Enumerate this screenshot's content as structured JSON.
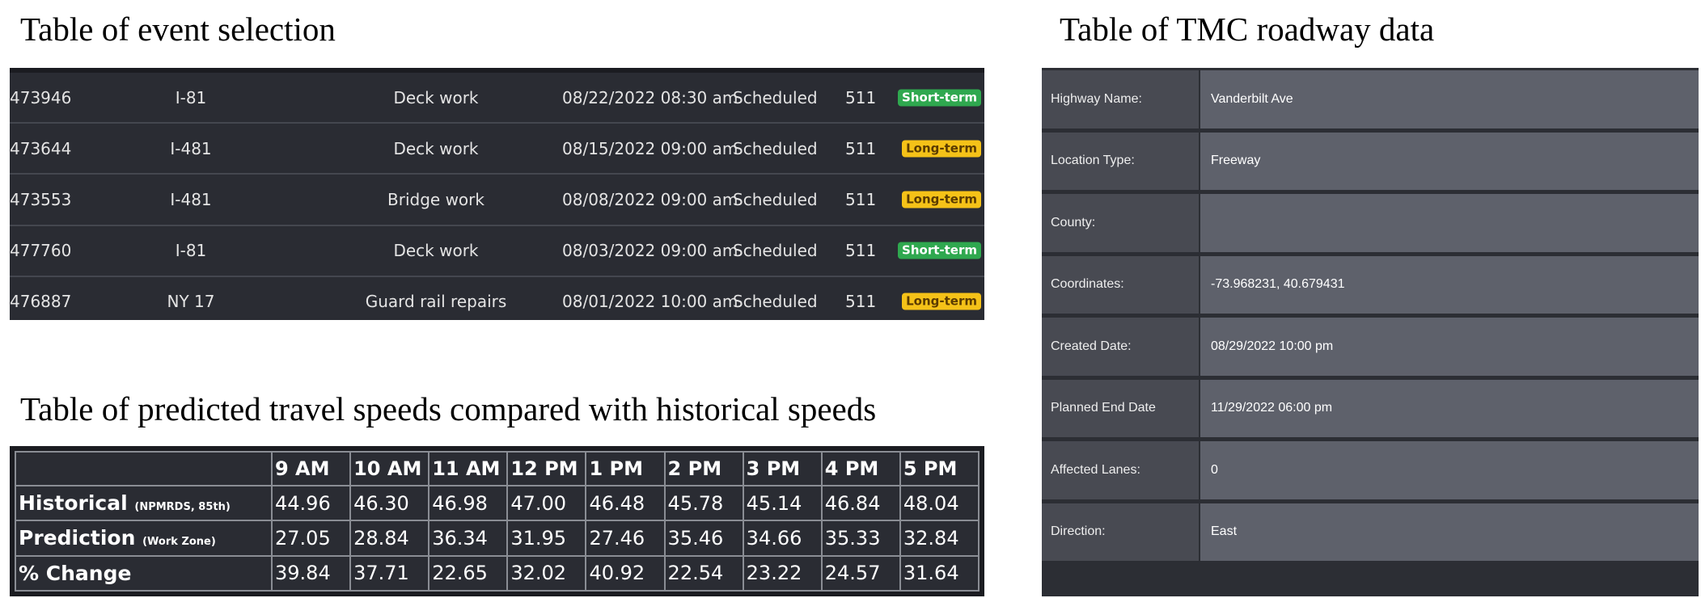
{
  "headings": {
    "events": "Table of event selection",
    "speeds": "Table of predicted travel speeds compared with historical speeds",
    "tmc": "Table of TMC roadway data"
  },
  "events": [
    {
      "id": "473946",
      "road": "I-81",
      "type": "Deck work",
      "date": "08/22/2022 08:30 am",
      "status": "Scheduled",
      "source": "511",
      "duration": "Short-term"
    },
    {
      "id": "473644",
      "road": "I-481",
      "type": "Deck work",
      "date": "08/15/2022 09:00 am",
      "status": "Scheduled",
      "source": "511",
      "duration": "Long-term"
    },
    {
      "id": "473553",
      "road": "I-481",
      "type": "Bridge work",
      "date": "08/08/2022 09:00 am",
      "status": "Scheduled",
      "source": "511",
      "duration": "Long-term"
    },
    {
      "id": "477760",
      "road": "I-81",
      "type": "Deck work",
      "date": "08/03/2022 09:00 am",
      "status": "Scheduled",
      "source": "511",
      "duration": "Short-term"
    },
    {
      "id": "476887",
      "road": "NY 17",
      "type": "Guard rail repairs",
      "date": "08/01/2022 10:00 am",
      "status": "Scheduled",
      "source": "511",
      "duration": "Long-term"
    }
  ],
  "speeds": {
    "hours": [
      "9 AM",
      "10 AM",
      "11 AM",
      "12 PM",
      "1 PM",
      "2 PM",
      "3 PM",
      "4 PM",
      "5 PM"
    ],
    "rows": [
      {
        "label": "Historical",
        "note": "(NPMRDS, 85th)",
        "values": [
          "44.96",
          "46.30",
          "46.98",
          "47.00",
          "46.48",
          "45.78",
          "45.14",
          "46.84",
          "48.04"
        ]
      },
      {
        "label": "Prediction",
        "note": "(Work Zone)",
        "values": [
          "27.05",
          "28.84",
          "36.34",
          "31.95",
          "27.46",
          "35.46",
          "34.66",
          "35.33",
          "32.84"
        ]
      },
      {
        "label": "% Change",
        "note": "",
        "values": [
          "39.84",
          "37.71",
          "22.65",
          "32.02",
          "40.92",
          "22.54",
          "23.22",
          "24.57",
          "31.64"
        ]
      }
    ]
  },
  "tmc": [
    {
      "label": "Highway Name:",
      "value": "Vanderbilt Ave"
    },
    {
      "label": "Location Type:",
      "value": "Freeway"
    },
    {
      "label": "County:",
      "value": ""
    },
    {
      "label": "Coordinates:",
      "value": "-73.968231, 40.679431"
    },
    {
      "label": "Created Date:",
      "value": "08/29/2022 10:00 pm"
    },
    {
      "label": "Planned End Date",
      "value": "11/29/2022 06:00 pm"
    },
    {
      "label": "Affected Lanes:",
      "value": "0"
    },
    {
      "label": "Direction:",
      "value": "East"
    }
  ],
  "colors": {
    "short_term_badge": "#2fa84f",
    "long_term_badge": "#f5c218",
    "table_background": "#2a2c33"
  }
}
